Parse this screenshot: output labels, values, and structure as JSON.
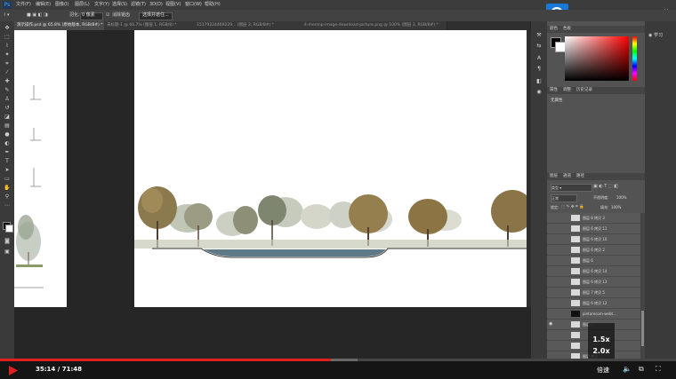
{
  "menubar": {
    "logo": "Ps",
    "items": [
      "文件(F)",
      "编辑(E)",
      "图像(I)",
      "图层(L)",
      "文字(Y)",
      "选择(S)",
      "滤镜(T)",
      "3D(D)",
      "视图(V)",
      "窗口(W)",
      "帮助(H)"
    ]
  },
  "optionsbar": {
    "feather_label": "羽化:",
    "feather_value": "0 像素",
    "antialias_label": "消除锯齿",
    "select_mask_label": "选择并遮住..."
  },
  "tabs": [
    {
      "label": "演示操作.psd @ 65.8% (原始版本, RGB/8#) *",
      "active": true
    },
    {
      "label": "未标题-1 @ 66.7% (图层 1, RGB/8) *",
      "active": false
    },
    {
      "label": "15179224469229... (图层 2, RGB/8#) *",
      "active": false
    },
    {
      "label": "4-mersnp-image-download-picture.png @ 100% (图层 1, RGB/8#) *",
      "active": false
    }
  ],
  "panels": {
    "color_tabs": [
      "颜色",
      "色板"
    ],
    "props_tabs": [
      "属性",
      "调整",
      "历史记录"
    ],
    "props_empty": "无属性",
    "layers_tabs": [
      "图层",
      "通道",
      "路径"
    ],
    "filter_kind": "类型",
    "blend_mode": "正常",
    "opacity_label": "不透明度:",
    "opacity_value": "100%",
    "lock_label": "锁定:",
    "fill_label": "填充:",
    "fill_value": "100%",
    "learn_label": "学习"
  },
  "layers": [
    {
      "name": "图层 8 拷贝 3",
      "visible": false
    },
    {
      "name": "图层 6 拷贝 11",
      "visible": false
    },
    {
      "name": "图层 6 拷贝 10",
      "visible": false
    },
    {
      "name": "图层 6 拷贝 2",
      "visible": false
    },
    {
      "name": "图层 6",
      "visible": false
    },
    {
      "name": "图层 6 拷贝 14",
      "visible": false
    },
    {
      "name": "图层 6 拷贝 13",
      "visible": false
    },
    {
      "name": "图层 7 拷贝 5",
      "visible": false
    },
    {
      "name": "图层 6 拷贝 12",
      "visible": false
    },
    {
      "name": "pintarecom-webt...",
      "visible": false
    },
    {
      "name": "图层 ...",
      "visible": true
    },
    {
      "name": "",
      "visible": false
    },
    {
      "name": "",
      "visible": false
    },
    {
      "name": "图层 拷贝 ...",
      "visible": false
    }
  ],
  "speed_menu": [
    "1.5x",
    "2.0x"
  ],
  "player": {
    "current_time": "35:14",
    "separator": " / ",
    "duration": "71:48",
    "progress": 0.49,
    "buffered": 0.53,
    "quality_label": "倍速"
  },
  "colors": {
    "accent_red": "#e02020",
    "search_blue": "#1a78d6"
  }
}
